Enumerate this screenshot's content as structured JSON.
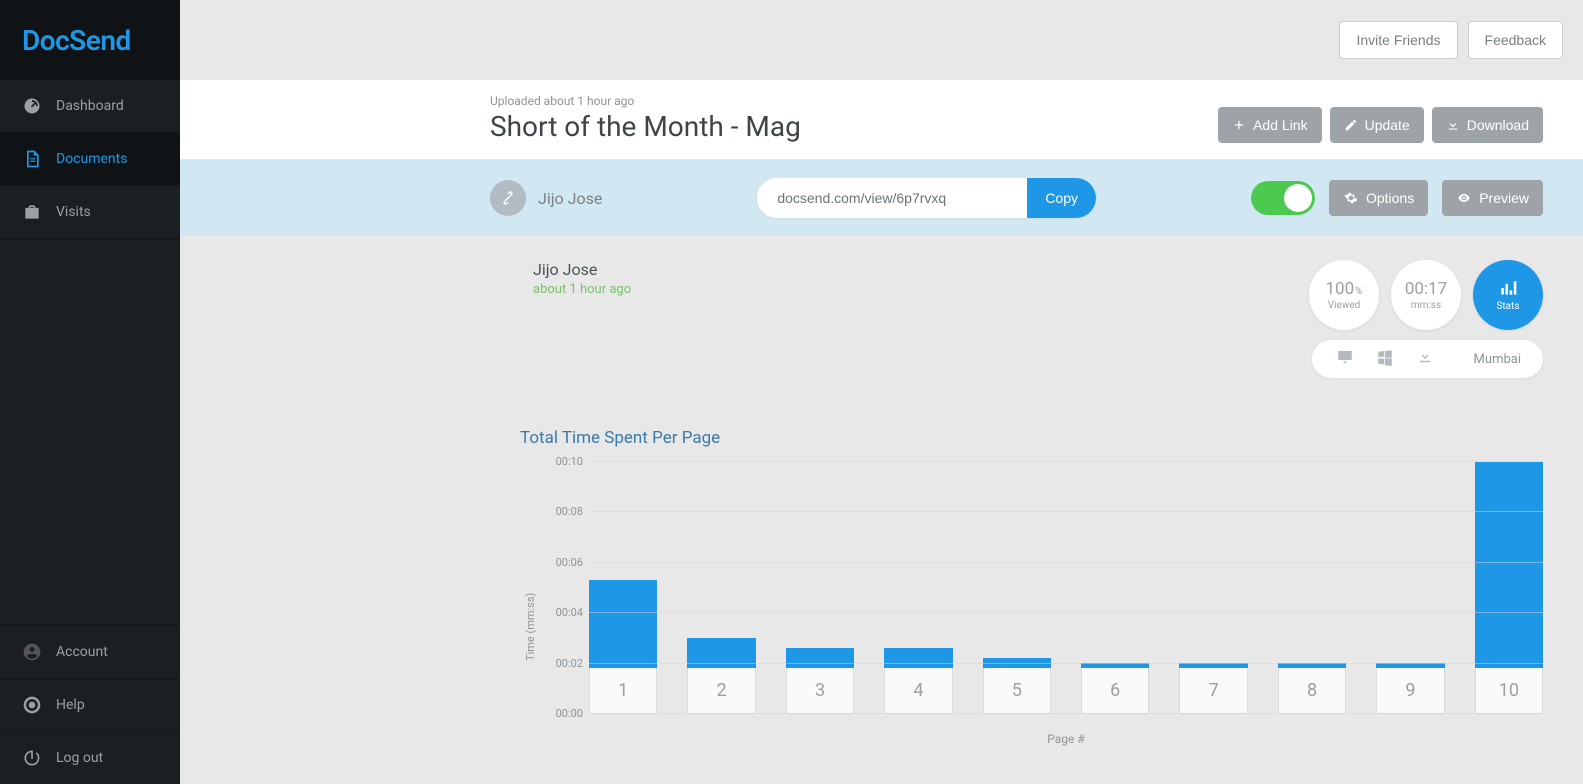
{
  "brand": "DocSend",
  "sidebar": {
    "nav": [
      {
        "key": "dashboard",
        "label": "Dashboard",
        "icon": "gauge"
      },
      {
        "key": "documents",
        "label": "Documents",
        "icon": "doc",
        "active": true
      },
      {
        "key": "visits",
        "label": "Visits",
        "icon": "briefcase"
      }
    ],
    "bottom": [
      {
        "key": "account",
        "label": "Account",
        "icon": "user"
      },
      {
        "key": "help",
        "label": "Help",
        "icon": "lifering"
      },
      {
        "key": "logout",
        "label": "Log out",
        "icon": "power"
      }
    ]
  },
  "topbar": {
    "invite": "Invite Friends",
    "feedback": "Feedback"
  },
  "header": {
    "uploaded": "Uploaded about 1 hour ago",
    "title": "Short of the Month - Mag",
    "buttons": {
      "add": "Add Link",
      "update": "Update",
      "download": "Download"
    }
  },
  "sharebar": {
    "owner": "Jijo Jose",
    "url": "docsend.com/view/6p7rvxq",
    "copy": "Copy",
    "toggle_on": true,
    "options": "Options",
    "preview": "Preview"
  },
  "visitor": {
    "name": "Jijo Jose",
    "when": "about 1 hour ago",
    "stats": {
      "viewed_value": "100",
      "viewed_unit": "%",
      "viewed_label": "Viewed",
      "time_value": "00:17",
      "time_label": "mm:ss",
      "stats_label": "Stats"
    },
    "location": "Mumbai"
  },
  "chart_data": {
    "type": "bar",
    "title": "Total Time Spent Per Page",
    "xlabel": "Page #",
    "ylabel": "Time (mm:ss)",
    "ylim": [
      0,
      10
    ],
    "yticks": [
      "00:00",
      "00:02",
      "00:04",
      "00:06",
      "00:08",
      "00:10"
    ],
    "categories": [
      "1",
      "2",
      "3",
      "4",
      "5",
      "6",
      "7",
      "8",
      "9",
      "10"
    ],
    "values_seconds": [
      3.5,
      1.2,
      0.8,
      0.8,
      0.4,
      0.2,
      0.2,
      0.2,
      0.2,
      8.9
    ]
  },
  "colors": {
    "accent": "#1e98e6",
    "green": "#4cc94f"
  }
}
